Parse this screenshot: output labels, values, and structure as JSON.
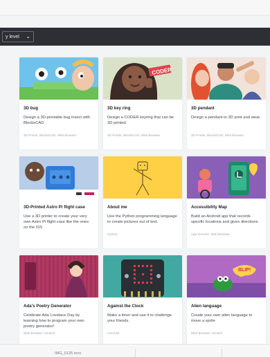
{
  "filter": {
    "label": "y level"
  },
  "cards": [
    {
      "title": "3D bug",
      "desc": "Design a 3D-printable bug insect with BlocksCAD",
      "tags": "3D Printer, BlocksCAD, Web Browser"
    },
    {
      "title": "3D key ring",
      "desc": "Design a CODER keyring that can be 3D printed.",
      "tags": "3D Printer, BlocksCAD, Web Browser"
    },
    {
      "title": "3D pendant",
      "desc": "Design a pendant to 3D print and wear.",
      "tags": "3D Printer, BlocksCAD, Web Browser"
    },
    {
      "title": "3D-Printed Astro Pi flight case",
      "desc": "Use a 3D printer to create your very own Astro Pi flight case like the ones on the ISS",
      "tags": ""
    },
    {
      "title": "About me",
      "desc": "Use the Python programming language to create pictures out of text.",
      "tags": "Python"
    },
    {
      "title": "Accessibility Map",
      "desc": "Build an Android app that records specific locations and gives directions",
      "tags": "App Inventor, Web Browser"
    },
    {
      "title": "Ada's Poetry Generator",
      "desc": "Celebrate Ada Lovelace Day by learning how to program your own poetry generator!",
      "tags": "Web Browser, Scratch"
    },
    {
      "title": "Against the Clock",
      "desc": "Make a timer and use it to challenge your friends.",
      "tags": "micro:bit"
    },
    {
      "title": "Alien language",
      "desc": "Create your own alien language to move a sprite",
      "tags": "Web Browser, Scratch"
    }
  ],
  "thumb_text": {
    "coder": "CODER",
    "blip": "BLIP!"
  },
  "footer": {
    "file": "IMG_0125.mov"
  }
}
